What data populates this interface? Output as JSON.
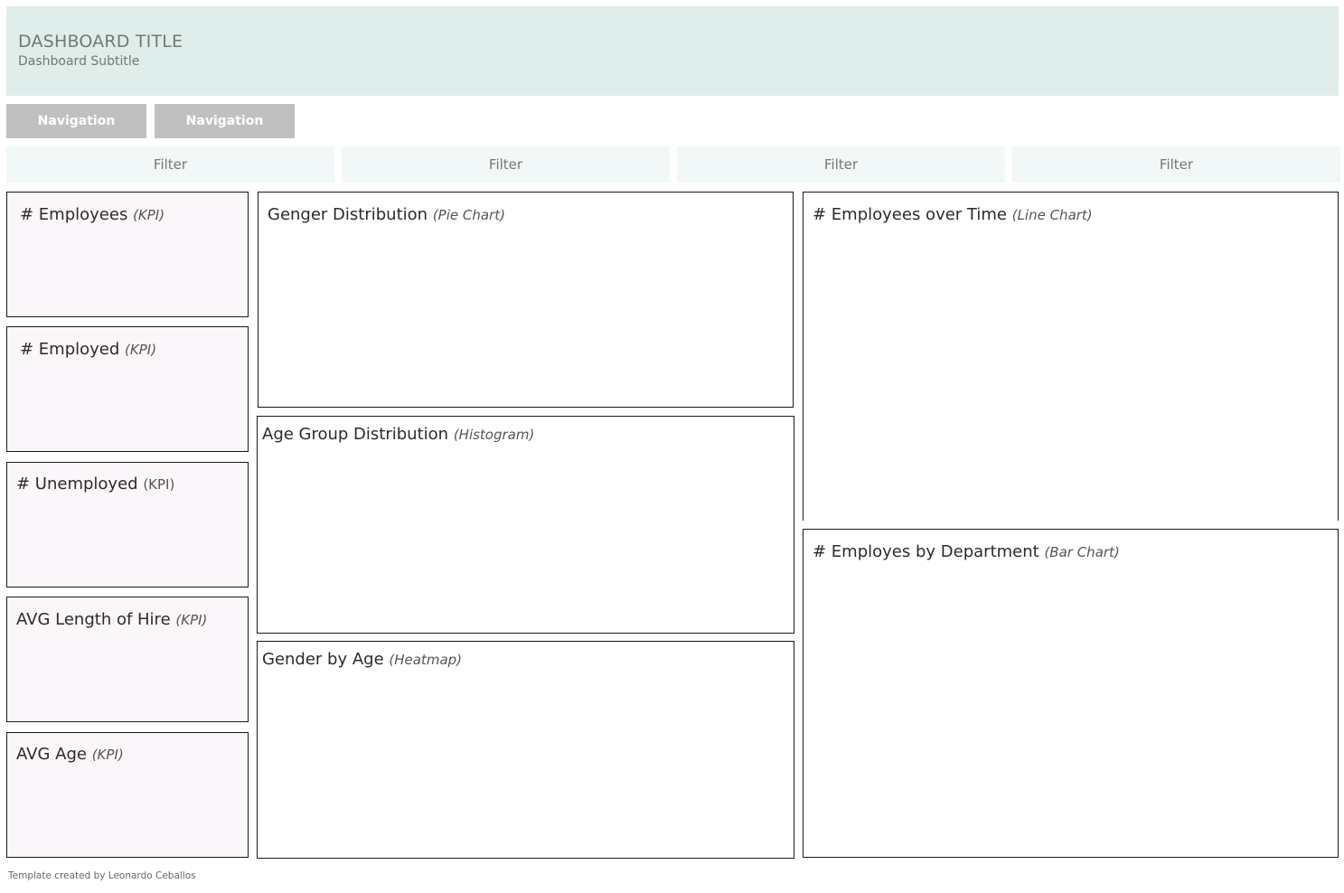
{
  "header": {
    "title": "DASHBOARD TITLE",
    "subtitle": "Dashboard Subtitle"
  },
  "navigation": [
    {
      "label": "Navigation"
    },
    {
      "label": "Navigation"
    }
  ],
  "filters": [
    {
      "label": "Filter"
    },
    {
      "label": "Filter"
    },
    {
      "label": "Filter"
    },
    {
      "label": "Filter"
    }
  ],
  "kpis": [
    {
      "name": "# Employees",
      "kind": "(KPI)"
    },
    {
      "name": "# Employed",
      "kind": "(KPI)"
    },
    {
      "name": "# Unemployed",
      "kind": "(KPI)"
    },
    {
      "name": "AVG Length of Hire",
      "kind": "(KPI)"
    },
    {
      "name": "AVG Age",
      "kind": "(KPI)"
    }
  ],
  "charts": [
    {
      "name": "Genger Distribution",
      "kind": "(Pie Chart)"
    },
    {
      "name": "Age Group Distribution",
      "kind": "(Histogram)"
    },
    {
      "name": "Gender by Age",
      "kind": "(Heatmap)"
    },
    {
      "name": "# Employees over Time",
      "kind": "(Line Chart)"
    },
    {
      "name": "# Employes by Department",
      "kind": "(Bar Chart)"
    }
  ],
  "footer": {
    "credit": "Template created by Leonardo Ceballos"
  },
  "colors": {
    "header_bg": "#dfeeea",
    "nav_bg": "#c0c0c0",
    "filter_bg": "#f1f8f7",
    "kpi_bg": "#fbf6f9",
    "border": "#1a1a1a"
  }
}
